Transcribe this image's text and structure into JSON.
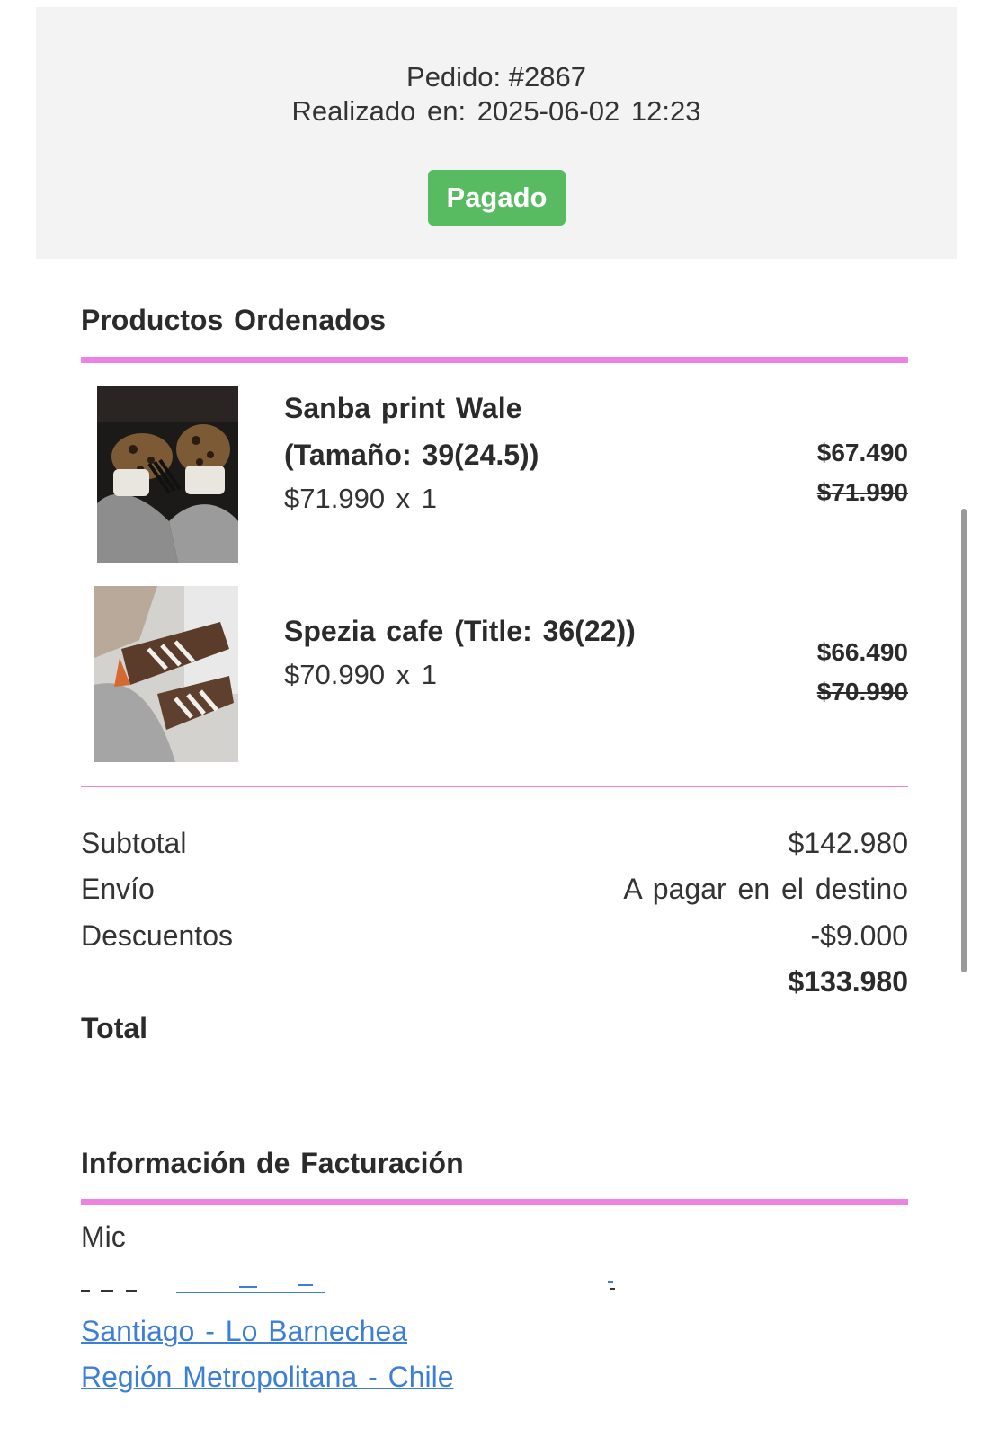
{
  "order": {
    "number_label": "Pedido: #2867",
    "placed_label": "Realizado en: 2025-06-02 12:23",
    "status": "Pagado",
    "status_color": "#58bb62"
  },
  "products_section": {
    "title": "Productos Ordenados",
    "accent_color": "#ee82e0",
    "items": [
      {
        "name_line1": "Sanba print Wale",
        "name_line2": "(Tamaño: 39(24.5))",
        "qty_line": "$71.990 x 1",
        "sale_price": "$67.490",
        "original_price": "$71.990",
        "image_icon": "sneaker-photo-leopard"
      },
      {
        "name_line1": "Spezia cafe (Title: 36(22))",
        "qty_line": "$70.990 x 1",
        "sale_price": "$66.490",
        "original_price": "$70.990",
        "image_icon": "sneaker-photo-brown"
      }
    ]
  },
  "summary": {
    "subtotal_label": "Subtotal",
    "subtotal_value": "$142.980",
    "shipping_label": "Envío",
    "shipping_value": "A pagar en el destino",
    "discounts_label": "Descuentos",
    "discounts_value": "-$9.000",
    "total_value": "$133.980",
    "total_label": "Total"
  },
  "billing": {
    "title": "Información de Facturación",
    "name_partial": "Mic",
    "city_line": "Santiago - Lo Barnechea",
    "region_line": "Región Metropolitana - Chile",
    "link_color": "#3d7fd6"
  }
}
